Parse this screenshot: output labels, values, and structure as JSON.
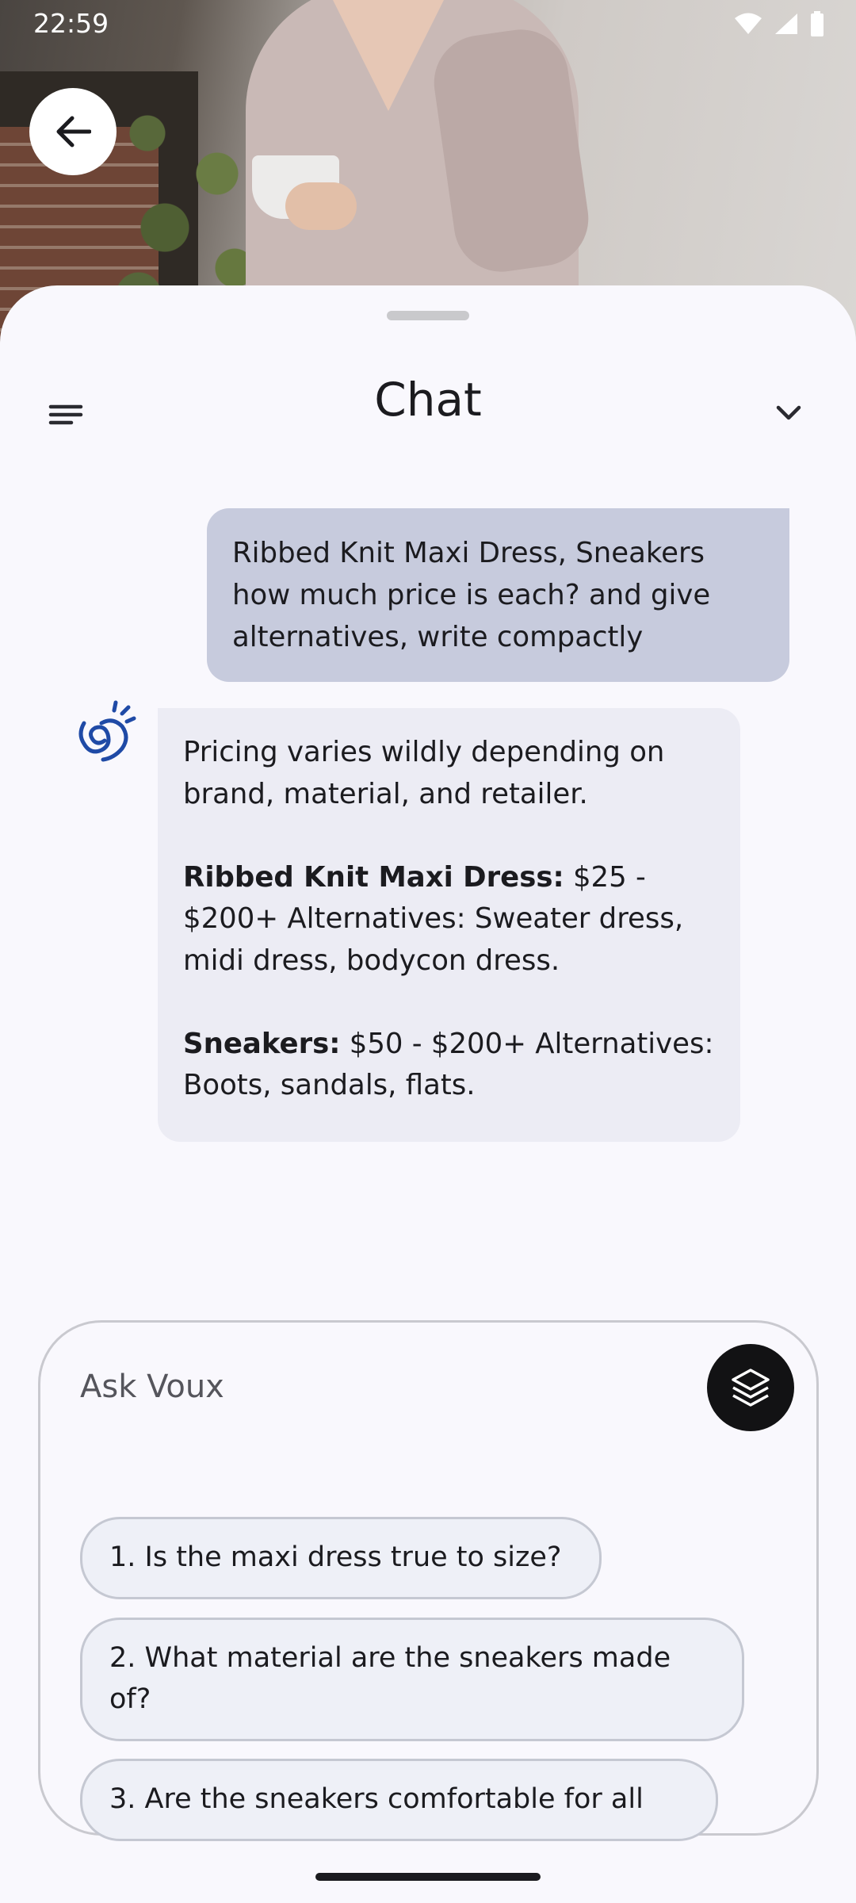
{
  "status_bar": {
    "time": "22:59",
    "icons": [
      "wifi-icon",
      "signal-icon",
      "battery-icon"
    ]
  },
  "hero": {
    "description_icon": "product-photo"
  },
  "header": {
    "title": "Chat",
    "menu_icon": "menu-icon",
    "collapse_icon": "chevron-down-icon",
    "back_icon": "arrow-left-icon"
  },
  "messages": {
    "user": "Ribbed Knit Maxi Dress, Sneakers how much price is each? and give alternatives, write compactly",
    "bot": {
      "intro": "Pricing varies wildly depending on brand, material, and retailer.",
      "item1_label": "Ribbed Knit Maxi Dress:",
      "item1_text": " $25 - $200+  Alternatives:  Sweater dress, midi dress, bodycon dress.",
      "item2_label": "Sneakers:",
      "item2_text": " $50 - $200+ Alternatives:  Boots, sandals, flats."
    }
  },
  "composer": {
    "placeholder": "Ask Voux",
    "action_icon": "layers-icon",
    "suggestions": [
      "1. Is the maxi dress true to size?",
      "2. What material are the sneakers made of?",
      "3.  Are the sneakers comfortable for all"
    ]
  },
  "colors": {
    "user_bubble": "#c7cbdd",
    "bot_bubble": "#ececf4",
    "background": "#f9f8fd",
    "bot_icon": "#1f4aa6"
  }
}
